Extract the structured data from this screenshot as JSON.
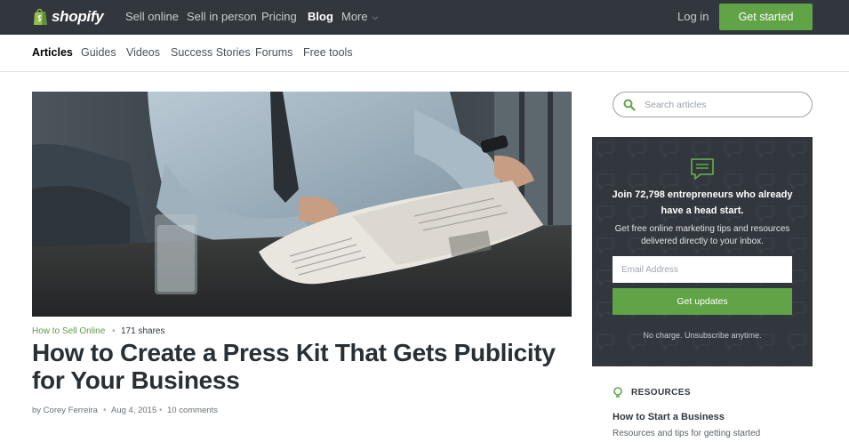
{
  "brand": {
    "name": "shopify",
    "accent": "#61a347",
    "dark": "#31373d"
  },
  "topnav": {
    "items": [
      {
        "label": "Sell online"
      },
      {
        "label": "Sell in person"
      },
      {
        "label": "Pricing"
      },
      {
        "label": "Blog",
        "active": true
      },
      {
        "label": "More"
      }
    ],
    "login": "Log in",
    "cta": "Get started"
  },
  "subnav": {
    "items": [
      {
        "label": "Articles",
        "active": true
      },
      {
        "label": "Guides"
      },
      {
        "label": "Videos"
      },
      {
        "label": "Success Stories"
      },
      {
        "label": "Forums"
      },
      {
        "label": "Free tools"
      }
    ]
  },
  "article": {
    "category": "How to Sell Online",
    "shares": "171 shares",
    "title": "How to Create a Press Kit That Gets Publicity for Your Business",
    "author": "by Corey Ferreira",
    "date": "Aug 4, 2015",
    "comments": "10 comments"
  },
  "search": {
    "placeholder": "Search articles",
    "value": ""
  },
  "newsletter": {
    "title": "Join 72,798 entrepreneurs who already have a head start.",
    "subtitle": "Get free online marketing tips and resources delivered directly to your inbox.",
    "email_placeholder": "Email Address",
    "email_value": "",
    "button": "Get updates",
    "note": "No charge. Unsubscribe anytime."
  },
  "resources": {
    "heading": "RESOURCES",
    "items": [
      {
        "title": "How to Start a Business",
        "desc": "Resources and tips for getting started"
      }
    ]
  }
}
